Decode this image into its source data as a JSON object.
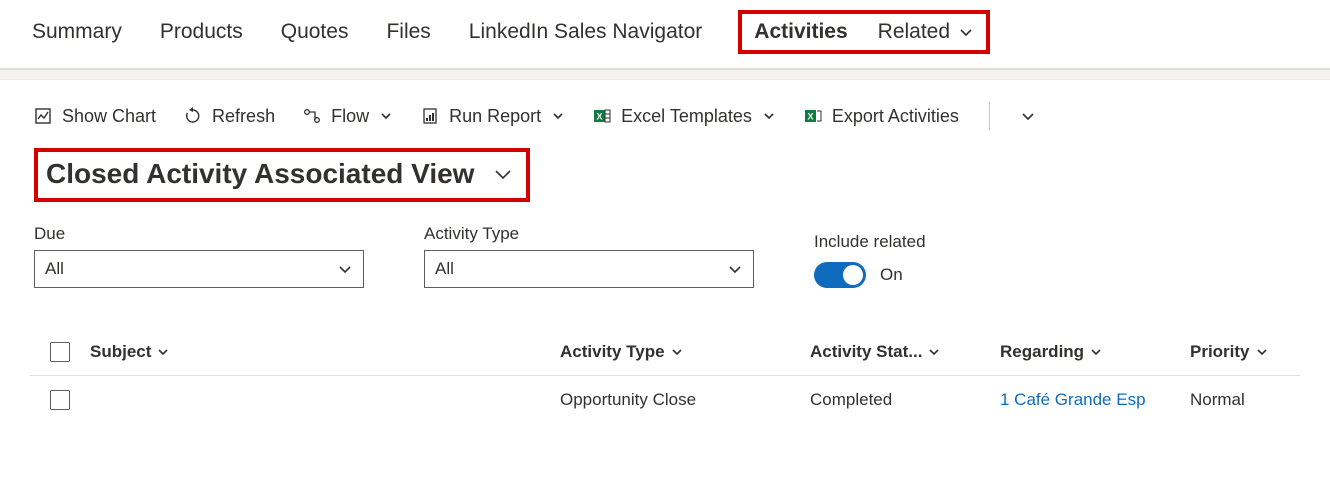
{
  "tabs": {
    "summary": "Summary",
    "products": "Products",
    "quotes": "Quotes",
    "files": "Files",
    "linkedin": "LinkedIn Sales Navigator",
    "activities": "Activities",
    "related": "Related"
  },
  "commands": {
    "show_chart": "Show Chart",
    "refresh": "Refresh",
    "flow": "Flow",
    "run_report": "Run Report",
    "excel_templates": "Excel Templates",
    "export_activities": "Export Activities"
  },
  "view": {
    "title": "Closed Activity Associated View"
  },
  "filters": {
    "due_label": "Due",
    "due_value": "All",
    "activity_type_label": "Activity Type",
    "activity_type_value": "All",
    "include_related_label": "Include related",
    "include_related_value": "On"
  },
  "columns": {
    "subject": "Subject",
    "activity_type": "Activity Type",
    "activity_status": "Activity Stat...",
    "regarding": "Regarding",
    "priority": "Priority"
  },
  "rows": [
    {
      "subject": "",
      "activity_type": "Opportunity Close",
      "activity_status": "Completed",
      "regarding": "1 Café Grande Esp",
      "priority": "Normal"
    }
  ]
}
